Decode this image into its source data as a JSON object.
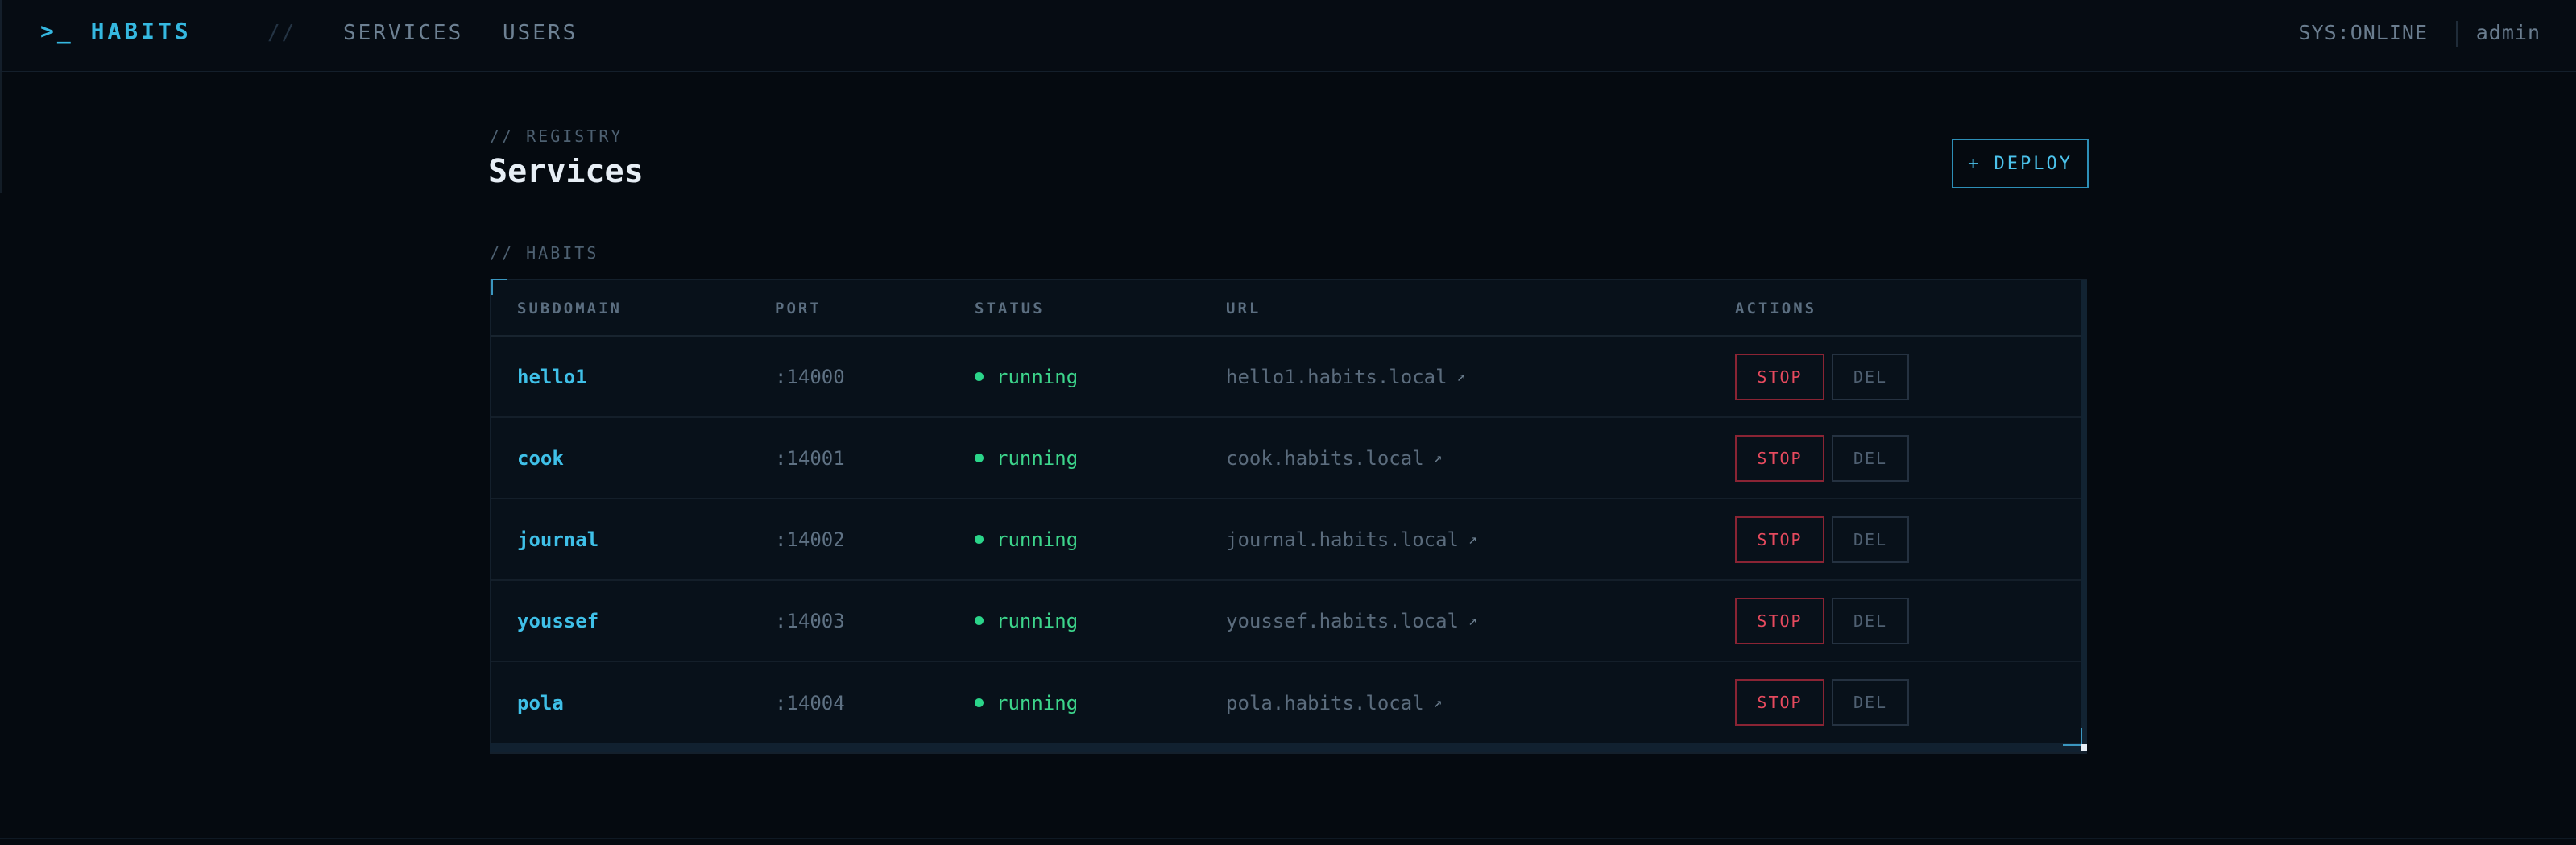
{
  "header": {
    "brand": ">_ HABITS",
    "nav_separator": "//",
    "nav": [
      {
        "label": "SERVICES"
      },
      {
        "label": "USERS"
      }
    ],
    "sys_status": "SYS:ONLINE",
    "user": "admin"
  },
  "page": {
    "eyebrow": "// REGISTRY",
    "title": "Services",
    "deploy_label": "+ DEPLOY",
    "section_label": "// HABITS"
  },
  "table": {
    "columns": [
      "SUBDOMAIN",
      "PORT",
      "STATUS",
      "URL",
      "ACTIONS"
    ],
    "rows": [
      {
        "subdomain": "hello1",
        "port": ":14000",
        "status": "running",
        "url": "hello1.habits.local",
        "stop": "STOP",
        "del": "DEL"
      },
      {
        "subdomain": "cook",
        "port": ":14001",
        "status": "running",
        "url": "cook.habits.local",
        "stop": "STOP",
        "del": "DEL"
      },
      {
        "subdomain": "journal",
        "port": ":14002",
        "status": "running",
        "url": "journal.habits.local",
        "stop": "STOP",
        "del": "DEL"
      },
      {
        "subdomain": "youssef",
        "port": ":14003",
        "status": "running",
        "url": "youssef.habits.local",
        "stop": "STOP",
        "del": "DEL"
      },
      {
        "subdomain": "pola",
        "port": ":14004",
        "status": "running",
        "url": "pola.habits.local",
        "stop": "STOP",
        "del": "DEL"
      }
    ],
    "external_link_glyph": "↗"
  },
  "colors": {
    "background": "#050a10",
    "accent": "#35b8e0",
    "running": "#3dd68c",
    "danger": "#e64a5e"
  },
  "icons": {
    "status": "status-dot-icon",
    "external": "external-link-icon"
  }
}
